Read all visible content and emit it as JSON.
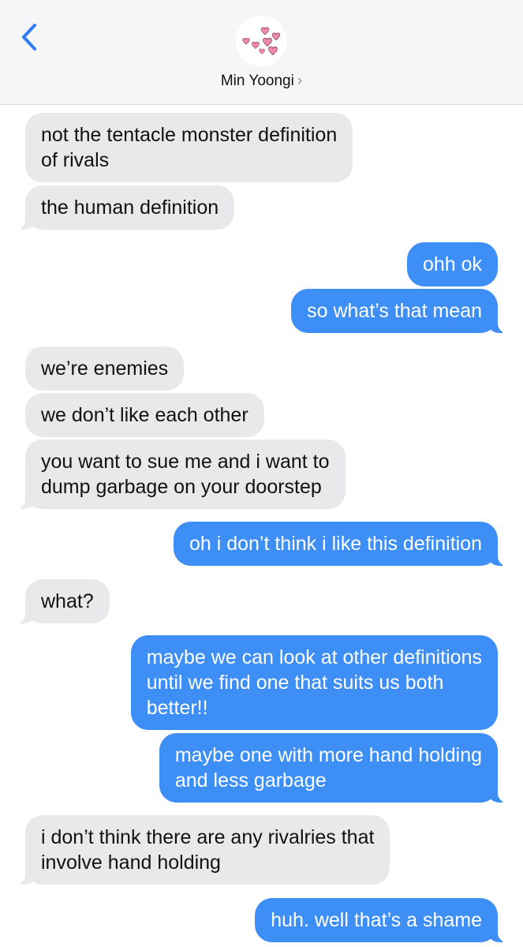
{
  "header": {
    "contact_name": "Min Yoongi",
    "chevron": "›",
    "avatar_icon": "pink-hearts-icon",
    "accent_color": "#2f7cf6"
  },
  "colors": {
    "received_bubble": "#e9e9eb",
    "sent_bubble": "#3d8ff5"
  },
  "messages": [
    {
      "from": "contact",
      "text": "not the tentacle monster definition\nof rivals"
    },
    {
      "from": "contact",
      "text": "the human definition"
    },
    {
      "from": "me",
      "text": "ohh ok"
    },
    {
      "from": "me",
      "text": "so what’s that mean"
    },
    {
      "from": "contact",
      "text": "we’re enemies"
    },
    {
      "from": "contact",
      "text": "we don’t like each other"
    },
    {
      "from": "contact",
      "text": "you want to sue me and i want to\ndump garbage on your doorstep"
    },
    {
      "from": "me",
      "text": "oh i don’t think i like this definition"
    },
    {
      "from": "contact",
      "text": "what?"
    },
    {
      "from": "me",
      "text": "maybe we can look at other definitions\nuntil we find one that suits us both\nbetter!!"
    },
    {
      "from": "me",
      "text": "maybe one with more hand holding\nand less garbage"
    },
    {
      "from": "contact",
      "text": "i don’t think there are any rivalries that\ninvolve hand holding"
    },
    {
      "from": "me",
      "text": "huh. well that’s a shame"
    }
  ]
}
